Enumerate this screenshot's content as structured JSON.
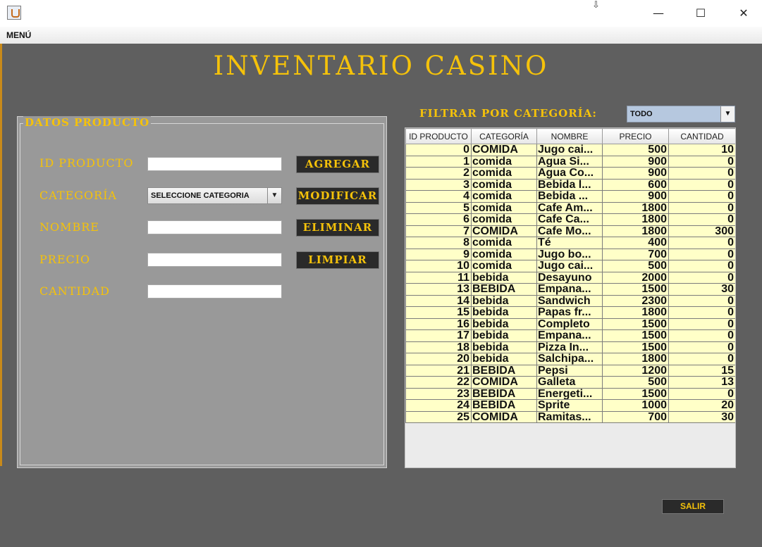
{
  "window": {
    "menu_label": "MENÚ"
  },
  "title": "INVENTARIO CASINO",
  "panel": {
    "legend": "DATOS PRODUCTO",
    "labels": {
      "id": "ID PRODUCTO",
      "categoria": "CATEGORÍA",
      "nombre": "NOMBRE",
      "precio": "PRECIO",
      "cantidad": "CANTIDAD"
    },
    "fields": {
      "id": "",
      "nombre": "",
      "precio": "",
      "cantidad": ""
    },
    "category_select": "SELECCIONE CATEGORIA",
    "buttons": {
      "agregar": "AGREGAR",
      "modificar": "MODIFICAR",
      "eliminar": "ELIMINAR",
      "limpiar": "LIMPIAR"
    }
  },
  "filter": {
    "label": "FILTRAR POR CATEGORÍA:",
    "selected": "TODO"
  },
  "table": {
    "columns": [
      "ID PRODUCTO",
      "CATEGORÍA",
      "NOMBRE",
      "PRECIO",
      "CANTIDAD"
    ],
    "rows": [
      [
        "0",
        "COMIDA",
        "Jugo cai...",
        "500",
        "10"
      ],
      [
        "1",
        "comida",
        "Agua Si...",
        "900",
        "0"
      ],
      [
        "2",
        "comida",
        "Agua Co...",
        "900",
        "0"
      ],
      [
        "3",
        "comida",
        "Bebida l...",
        "600",
        "0"
      ],
      [
        "4",
        "comida",
        "Bebida ...",
        "900",
        "0"
      ],
      [
        "5",
        "comida",
        "Cafe Am...",
        "1800",
        "0"
      ],
      [
        "6",
        "comida",
        "Cafe Ca...",
        "1800",
        "0"
      ],
      [
        "7",
        "COMIDA",
        "Cafe Mo...",
        "1800",
        "300"
      ],
      [
        "8",
        "comida",
        "Té",
        "400",
        "0"
      ],
      [
        "9",
        "comida",
        "Jugo bo...",
        "700",
        "0"
      ],
      [
        "10",
        "comida",
        "Jugo cai...",
        "500",
        "0"
      ],
      [
        "11",
        "bebida",
        "Desayuno",
        "2000",
        "0"
      ],
      [
        "13",
        "BEBIDA",
        "Empana...",
        "1500",
        "30"
      ],
      [
        "14",
        "bebida",
        "Sandwich",
        "2300",
        "0"
      ],
      [
        "15",
        "bebida",
        "Papas fr...",
        "1800",
        "0"
      ],
      [
        "16",
        "bebida",
        "Completo",
        "1500",
        "0"
      ],
      [
        "17",
        "bebida",
        "Empana...",
        "1500",
        "0"
      ],
      [
        "18",
        "bebida",
        "Pizza In...",
        "1500",
        "0"
      ],
      [
        "20",
        "bebida",
        "Salchipa...",
        "1800",
        "0"
      ],
      [
        "21",
        "BEBIDA",
        "Pepsi",
        "1200",
        "15"
      ],
      [
        "22",
        "COMIDA",
        "Galleta",
        "500",
        "13"
      ],
      [
        "23",
        "BEBIDA",
        "Energeti...",
        "1500",
        "0"
      ],
      [
        "24",
        "BEBIDA",
        "Sprite",
        "1000",
        "20"
      ],
      [
        "25",
        "COMIDA",
        "Ramitas...",
        "700",
        "30"
      ]
    ]
  },
  "salir_label": "SALIR",
  "colors": {
    "accent": "#f5c20a",
    "background": "#5f5f5f",
    "panel": "#999999",
    "table_cell": "#ffffc8",
    "button": "#2a2a2a"
  }
}
